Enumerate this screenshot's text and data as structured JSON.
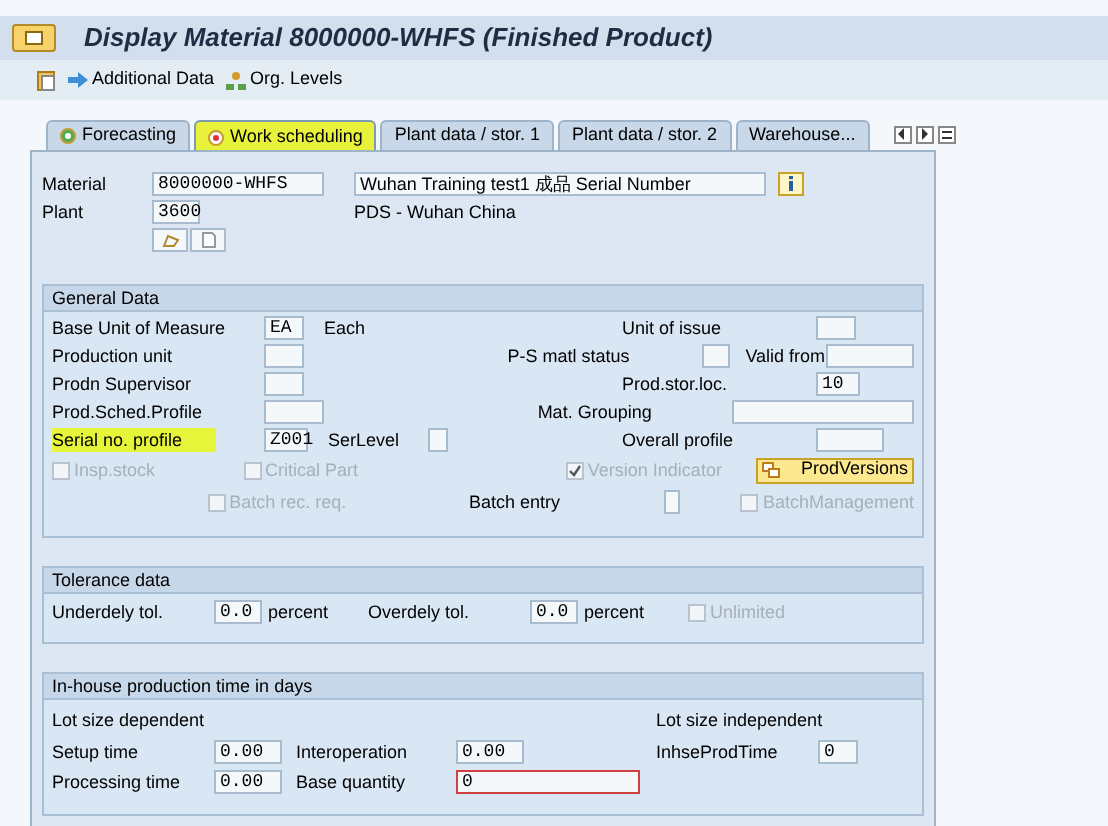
{
  "title_bar": {
    "title": "Display Material 8000000-WHFS (Finished Product)"
  },
  "toolbar": [
    {
      "label": "Additional Data"
    },
    {
      "label": "Org. Levels"
    }
  ],
  "tabs": [
    {
      "label": "Forecasting",
      "selected": false,
      "highlighted": false
    },
    {
      "label": "Work scheduling",
      "selected": true,
      "highlighted": true
    },
    {
      "label": "Plant data / stor. 1",
      "selected": false,
      "highlighted": false
    },
    {
      "label": "Plant data / stor. 2",
      "selected": false,
      "highlighted": false
    },
    {
      "label": "Warehouse...",
      "selected": false,
      "highlighted": false
    }
  ],
  "header": {
    "material": {
      "label": "Material",
      "value": "8000000-WHFS",
      "description": "Wuhan Training test1 成品 Serial Number"
    },
    "plant": {
      "label": "Plant",
      "value": "3600",
      "description": "PDS - Wuhan China"
    }
  },
  "general_data": {
    "title": "General Data",
    "rows": [
      {
        "label": "Base Unit of Measure",
        "value": "EA",
        "note": "Each",
        "highlighted": false,
        "right": {
          "label": "Unit of issue"
        }
      },
      {
        "label": "Production unit",
        "highlighted": false,
        "right": {
          "label": "P-S matl status",
          "extra_label": "Valid from"
        }
      },
      {
        "label": "Prodn Supervisor",
        "highlighted": false,
        "right": {
          "label": "Prod.stor.loc.",
          "value": "10"
        }
      },
      {
        "label": "Prod.Sched.Profile",
        "highlighted": false,
        "right": {
          "label": "Mat. Grouping"
        }
      },
      {
        "label": "Serial no. profile",
        "value": "Z001",
        "note": "SerLevel",
        "has_box": true,
        "highlighted": true,
        "right": {
          "label": "Overall profile"
        }
      }
    ],
    "checks": [
      {
        "label": "Insp.stock",
        "checked": false,
        "disabled": true
      },
      {
        "label": "Critical Part",
        "checked": false,
        "disabled": true
      },
      {
        "label": "Version Indicator",
        "checked": true,
        "disabled": true
      },
      {
        "label": "Batch rec. req.",
        "checked": false,
        "disabled": true
      },
      {
        "label": "BatchManagement",
        "checked": false,
        "disabled": true
      }
    ],
    "prod_versions_button": "ProdVersions",
    "batch_entry": {
      "label": "Batch entry"
    }
  },
  "tolerance": {
    "title": "Tolerance data",
    "fields": [
      {
        "label": "Underdely tol.",
        "value": "0.0",
        "unit": "percent"
      },
      {
        "label": "Overdely tol.",
        "value": "0.0",
        "unit": "percent"
      }
    ],
    "unlimited": {
      "label": "Unlimited",
      "checked": false,
      "disabled": true
    }
  },
  "inhouse": {
    "title": "In-house production time in days",
    "dependent_heading": "Lot size dependent",
    "independent_heading": "Lot size independent",
    "setup": {
      "label": "Setup time",
      "value": "0.00"
    },
    "interoperation": {
      "label": "Interoperation",
      "value": "0.00"
    },
    "inhouse_time": {
      "label": "InhseProdTime",
      "value": "0"
    },
    "processing": {
      "label": "Processing time",
      "value": "0.00"
    },
    "base_quantity": {
      "label": "Base quantity",
      "value": "0",
      "focused": true
    }
  }
}
